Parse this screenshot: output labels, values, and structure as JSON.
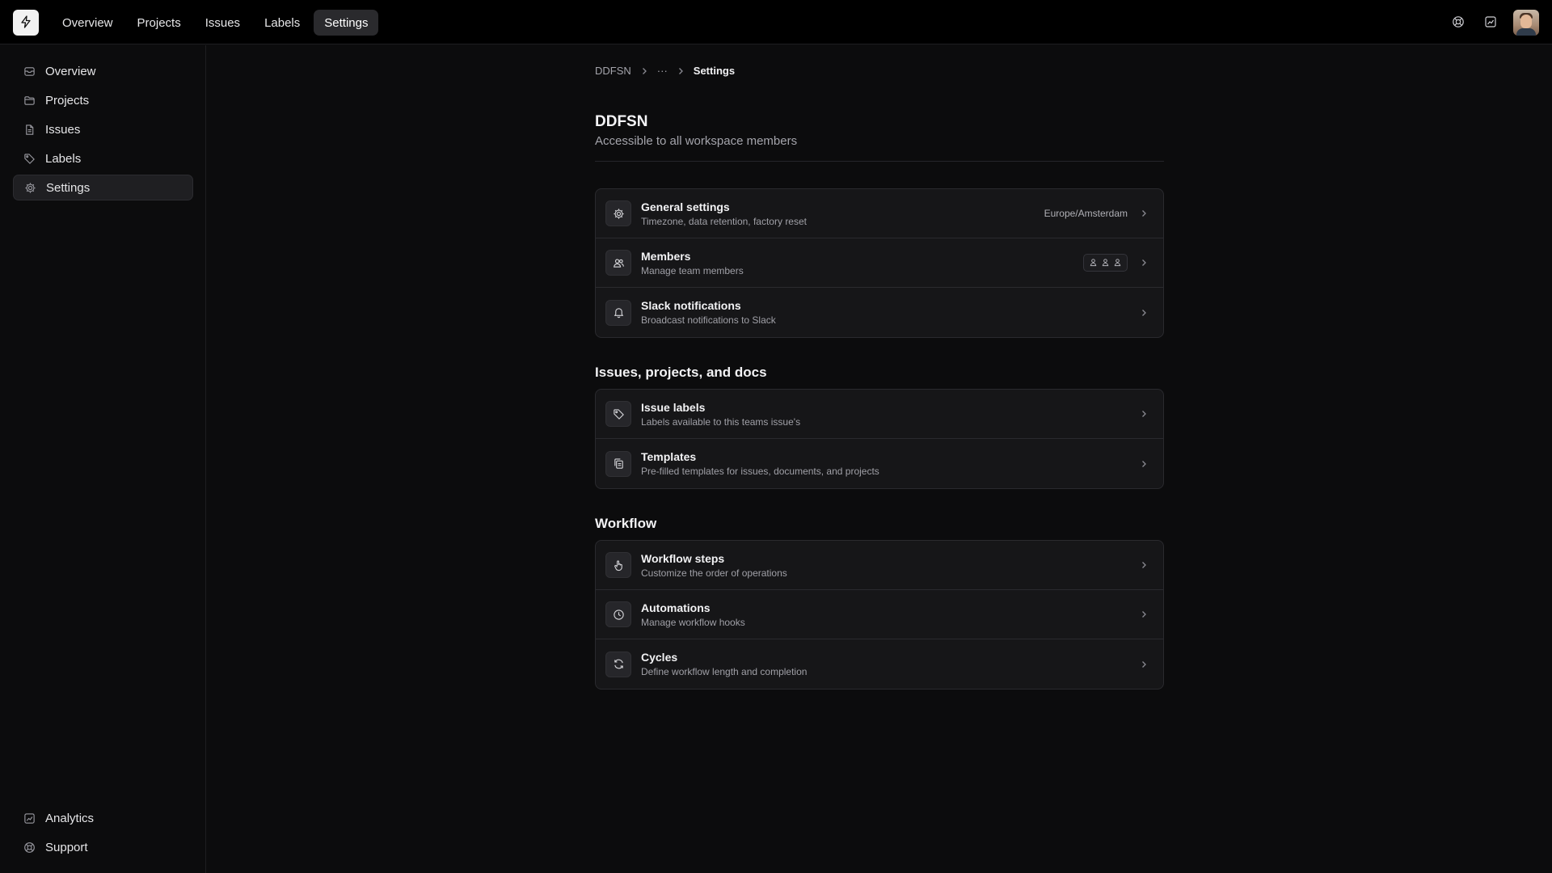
{
  "topnav": {
    "items": [
      {
        "label": "Overview",
        "active": false
      },
      {
        "label": "Projects",
        "active": false
      },
      {
        "label": "Issues",
        "active": false
      },
      {
        "label": "Labels",
        "active": false
      },
      {
        "label": "Settings",
        "active": true
      }
    ]
  },
  "sidebar": {
    "items": [
      {
        "label": "Overview",
        "icon": "inbox-icon"
      },
      {
        "label": "Projects",
        "icon": "folder-icon"
      },
      {
        "label": "Issues",
        "icon": "document-icon"
      },
      {
        "label": "Labels",
        "icon": "tag-icon"
      },
      {
        "label": "Settings",
        "icon": "gear-icon",
        "active": true
      }
    ],
    "bottom": [
      {
        "label": "Analytics",
        "icon": "chart-icon"
      },
      {
        "label": "Support",
        "icon": "lifebuoy-icon"
      }
    ]
  },
  "breadcrumb": {
    "root": "DDFSN",
    "ellipsis": "···",
    "current": "Settings"
  },
  "workspace": {
    "title": "DDFSN",
    "subtitle": "Accessible to all workspace members"
  },
  "general": {
    "rows": [
      {
        "title": "General settings",
        "desc": "Timezone, data retention, factory reset",
        "value": "Europe/Amsterdam",
        "icon": "gear-icon"
      },
      {
        "title": "Members",
        "desc": "Manage team members",
        "icon": "users-icon"
      },
      {
        "title": "Slack notifications",
        "desc": "Broadcast notifications to Slack",
        "icon": "bell-icon"
      }
    ]
  },
  "issues_section": {
    "title": "Issues, projects, and docs",
    "rows": [
      {
        "title": "Issue labels",
        "desc": "Labels available to this teams issue's",
        "icon": "tag-icon"
      },
      {
        "title": "Templates",
        "desc": "Pre-filled templates for issues, documents, and projects",
        "icon": "copy-icon"
      }
    ]
  },
  "workflow_section": {
    "title": "Workflow",
    "rows": [
      {
        "title": "Workflow steps",
        "desc": "Customize the order of operations",
        "icon": "hand-pointer-icon"
      },
      {
        "title": "Automations",
        "desc": "Manage workflow hooks",
        "icon": "clock-icon"
      },
      {
        "title": "Cycles",
        "desc": "Define workflow length and completion",
        "icon": "refresh-icon"
      }
    ]
  }
}
